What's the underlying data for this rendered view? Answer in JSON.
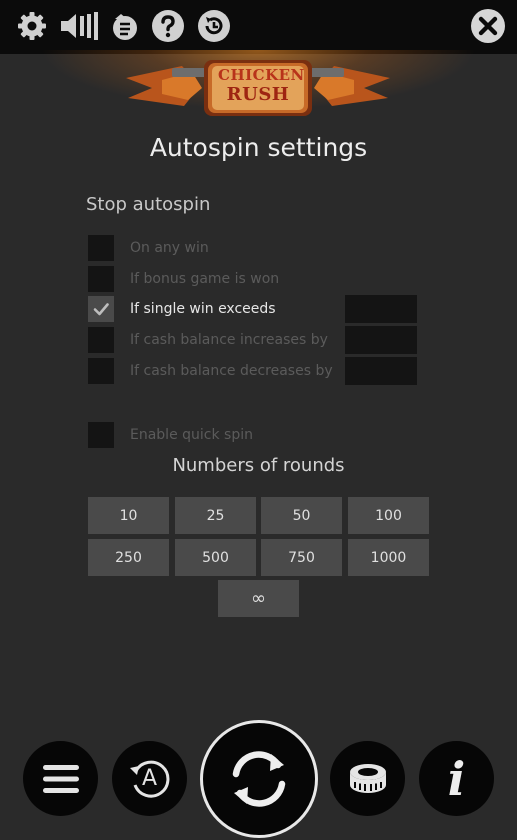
{
  "header": {
    "icons": [
      "gear-icon",
      "sound-icon",
      "stake-icon",
      "help-icon",
      "history-icon",
      "close-icon"
    ]
  },
  "logo": {
    "line1": "CHICKEN",
    "line2": "RUSH"
  },
  "title": "Autospin settings",
  "stop": {
    "heading": "Stop autospin",
    "options": [
      {
        "label": "On any win",
        "checked": false,
        "enabled": false
      },
      {
        "label": "If bonus game is won",
        "checked": false,
        "enabled": false
      },
      {
        "label": "If single win exceeds",
        "checked": true,
        "enabled": true,
        "value": ""
      },
      {
        "label": "If cash balance increases by",
        "checked": false,
        "enabled": false,
        "value": ""
      },
      {
        "label": "If cash balance decreases by",
        "checked": false,
        "enabled": false,
        "value": ""
      }
    ]
  },
  "quick_spin": {
    "label": "Enable quick spin",
    "checked": false
  },
  "rounds": {
    "heading": "Numbers of rounds",
    "options": [
      "10",
      "25",
      "50",
      "100",
      "250",
      "500",
      "750",
      "1000",
      "∞"
    ]
  },
  "bottom_bar": {
    "icons": [
      "menu-icon",
      "autoplay-icon",
      "spin-icon",
      "coin-stack-icon",
      "info-icon"
    ],
    "autoplay_letter": "A",
    "info_letter": "i"
  },
  "colors": {
    "background": "#2a2a2a",
    "topbar": "#0b0b0b",
    "checkbox": "#141414",
    "round_button": "#4a4a4a",
    "glow": "#ff9628"
  }
}
